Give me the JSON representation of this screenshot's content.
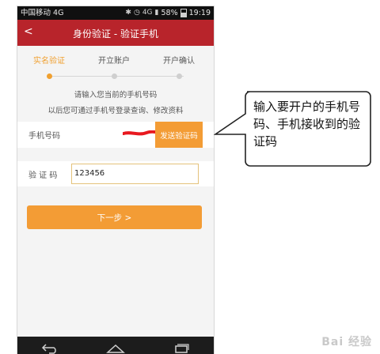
{
  "status_bar": {
    "carrier": "中国移动 4G",
    "network": "4G",
    "battery": "58%",
    "time": "19:19"
  },
  "header": {
    "back_label": "<",
    "title": "身份验证 - 验证手机"
  },
  "steps": [
    {
      "label": "实名验证",
      "active": true
    },
    {
      "label": "开立账户",
      "active": false
    },
    {
      "label": "开户确认",
      "active": false
    }
  ],
  "tips": {
    "line1": "请输入您当前的手机号码",
    "line2": "以后您可通过手机号登录查询、修改资料"
  },
  "form": {
    "phone_label": "手机号码",
    "send_code_label": "发送验证码",
    "code_label": "验 证 码",
    "code_value": "123456",
    "next_label": "下一步 >"
  },
  "callout": {
    "text": "输入要开户的手机号码、手机接收到的验证码"
  },
  "watermark": "Bai 经验",
  "colors": {
    "header_bg": "#b8242b",
    "accent": "#f39c35",
    "step_active": "#f0a030"
  },
  "icons": {
    "nav_back": "back-arrow-icon",
    "nav_home": "home-icon",
    "nav_recent": "recent-apps-icon"
  }
}
